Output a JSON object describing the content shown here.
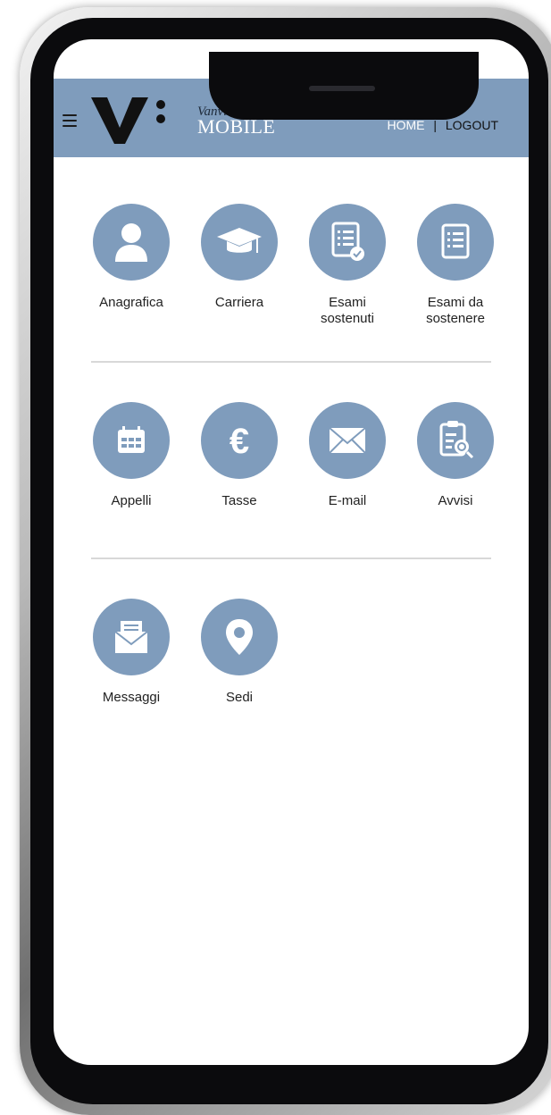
{
  "header": {
    "logo_small": "Vanvitelli",
    "logo_big": "MOBILE",
    "nav_home": "HOME",
    "nav_separator": "|",
    "nav_logout": "LOGOUT"
  },
  "menu": {
    "rows": [
      {
        "items": [
          {
            "label": "Anagrafica",
            "icon": "user-icon"
          },
          {
            "label": "Carriera",
            "icon": "graduation-cap-icon"
          },
          {
            "label": "Esami\nsostenuti",
            "icon": "document-check-icon"
          },
          {
            "label": "Esami da\nsostenere",
            "icon": "document-list-icon"
          }
        ]
      },
      {
        "items": [
          {
            "label": "Appelli",
            "icon": "calendar-icon"
          },
          {
            "label": "Tasse",
            "icon": "euro-icon"
          },
          {
            "label": "E-mail",
            "icon": "envelope-icon"
          },
          {
            "label": "Avvisi",
            "icon": "clipboard-search-icon"
          }
        ]
      },
      {
        "items": [
          {
            "label": "Messaggi",
            "icon": "message-envelope-icon"
          },
          {
            "label": "Sedi",
            "icon": "location-pin-icon"
          }
        ]
      }
    ]
  },
  "colors": {
    "accent": "#7f9cbc",
    "text": "#222222",
    "divider": "#d8d8d8"
  }
}
